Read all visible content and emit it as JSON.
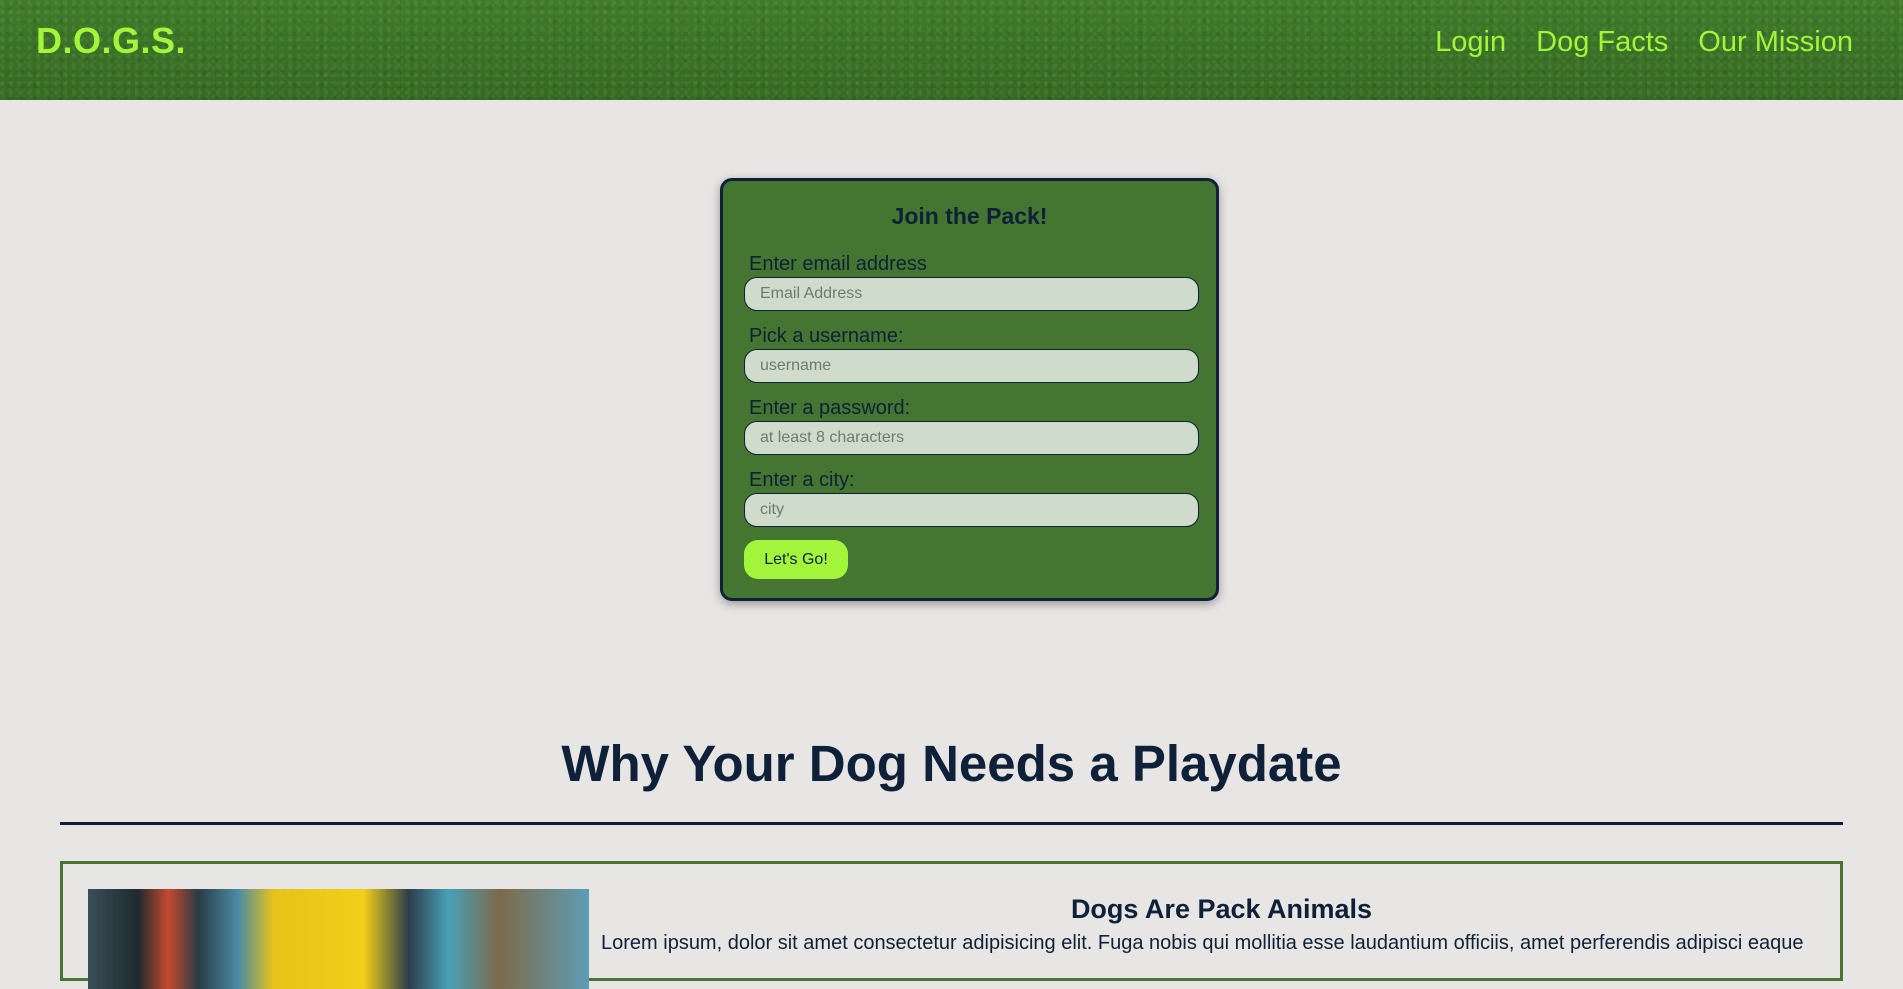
{
  "header": {
    "logo": "D.O.G.S.",
    "nav": [
      {
        "label": "Login"
      },
      {
        "label": "Dog Facts"
      },
      {
        "label": "Our Mission"
      }
    ]
  },
  "signup": {
    "title": "Join the Pack!",
    "fields": [
      {
        "label": "Enter email address",
        "placeholder": "Email Address",
        "value": ""
      },
      {
        "label": "Pick a username:",
        "placeholder": "username",
        "value": ""
      },
      {
        "label": "Enter a password:",
        "placeholder": "at least 8 characters",
        "value": ""
      },
      {
        "label": "Enter a city:",
        "placeholder": "city",
        "value": ""
      }
    ],
    "submit_label": "Let's Go!"
  },
  "section": {
    "title": "Why Your Dog Needs a Playdate"
  },
  "card": {
    "title": "Dogs Are Pack Animals",
    "text": "Lorem ipsum, dolor sit amet consectetur adipisicing elit. Fuga nobis qui mollitia esse laudantium officiis, amet perferendis adipisci eaque"
  },
  "colors": {
    "header_bg": "#3c7326",
    "accent_lime": "#a3f53b",
    "form_bg": "#447531",
    "text_navy": "#0e2138",
    "input_bg": "#d0dccb",
    "page_bg": "#e8e5e5"
  }
}
